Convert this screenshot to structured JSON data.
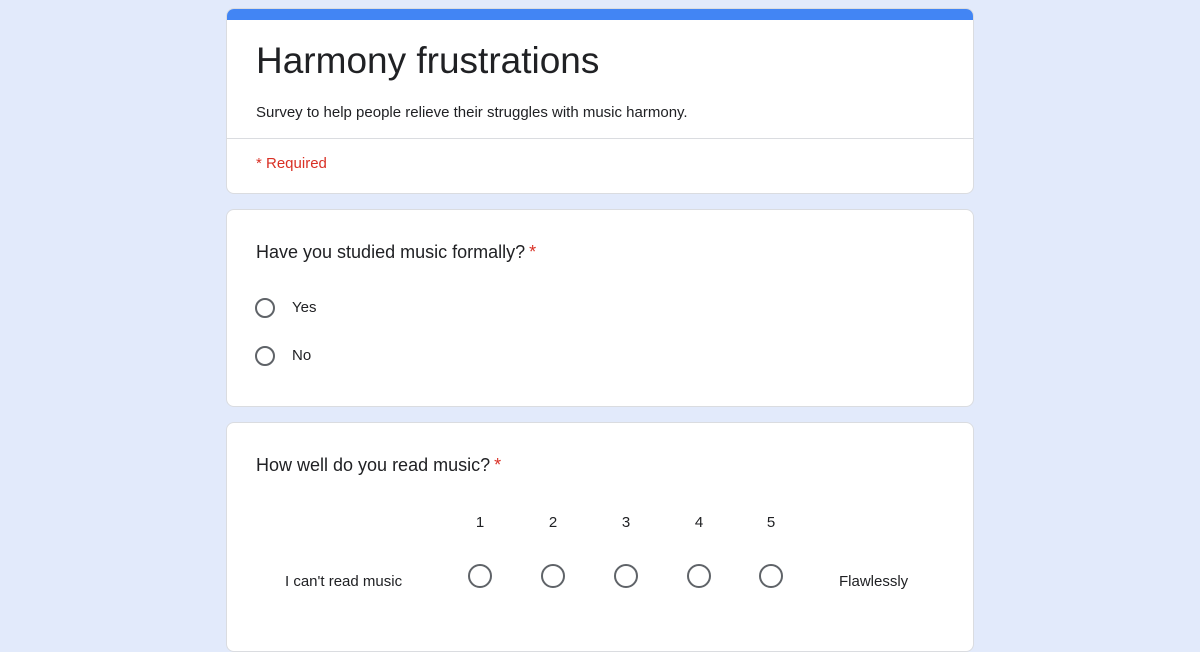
{
  "form": {
    "title": "Harmony frustrations",
    "description": "Survey to help people relieve their struggles with music harmony.",
    "required_note": "* Required"
  },
  "colors": {
    "accent": "#4285f4",
    "required": "#d93025",
    "background": "#e2eafb"
  },
  "questions": [
    {
      "title": "Have you studied music formally?",
      "required_mark": "*",
      "type": "multiple_choice",
      "options": [
        {
          "label": "Yes",
          "selected": false
        },
        {
          "label": "No",
          "selected": false
        }
      ]
    },
    {
      "title": "How well do you read music?",
      "required_mark": "*",
      "type": "linear_scale",
      "low_label": "I can't read music",
      "high_label": "Flawlessly",
      "scale": [
        "1",
        "2",
        "3",
        "4",
        "5"
      ],
      "selected": null
    }
  ]
}
